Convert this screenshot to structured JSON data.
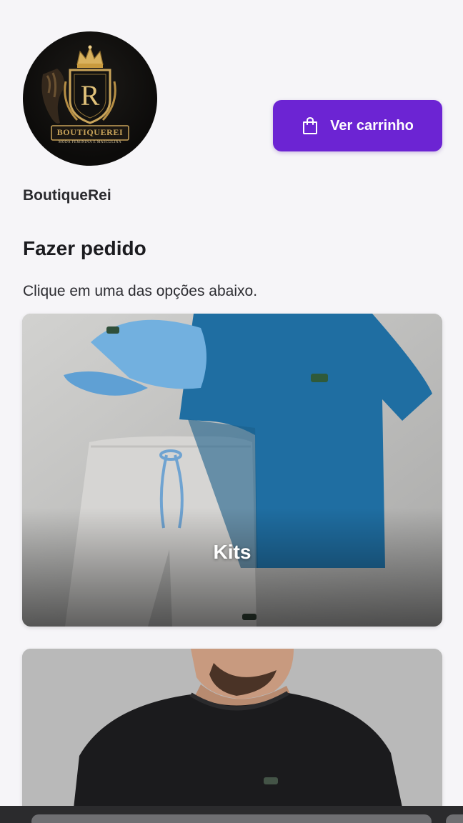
{
  "store": {
    "name": "BoutiqueRei",
    "logo": {
      "monogram": "R",
      "brand": "BOUTIQUEREI",
      "tagline": "MODA FEMININA E MASCULINA"
    }
  },
  "header": {
    "cart_button_label": "Ver carrinho",
    "cart_icon": "shopping-bag-icon"
  },
  "main": {
    "title": "Fazer pedido",
    "subtitle": "Clique em uma das opções abaixo.",
    "categories": [
      {
        "label": "Kits"
      },
      {
        "label": ""
      }
    ]
  },
  "colors": {
    "accent": "#6c24d3",
    "background": "#f6f5f8",
    "logo_gold": "#c9a45a"
  }
}
